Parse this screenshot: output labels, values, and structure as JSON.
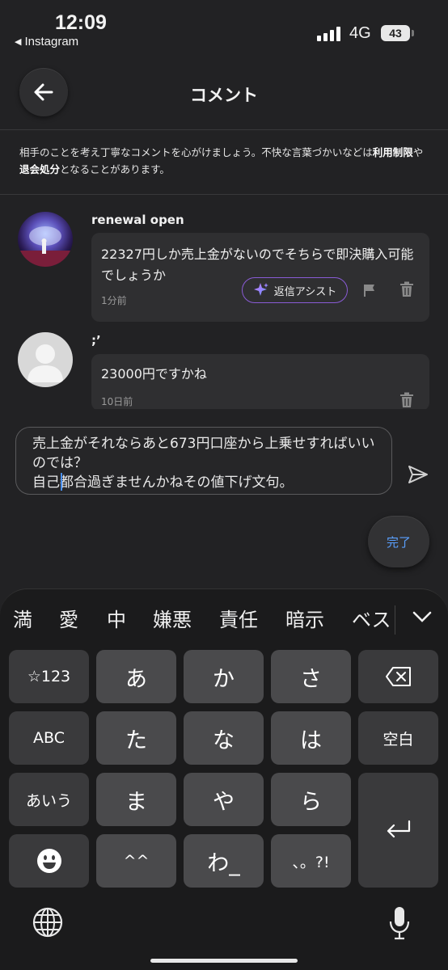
{
  "status_bar": {
    "time": "12:09",
    "back_app": "Instagram",
    "network": "4G",
    "battery": "43"
  },
  "header": {
    "title": "コメント"
  },
  "notice": {
    "text_1": "相手のことを考え丁寧なコメントを心がけましょう。不快な言葉づかいなどは",
    "bold_1": "利用制限",
    "text_2": "や",
    "bold_2": "退会処分",
    "text_3": "となることがあります。"
  },
  "comments": [
    {
      "username": "renewal open",
      "text": "22327円しか売上金がないのでそちらで即決購入可能でしょうか",
      "time": "1分前",
      "assist_label": "返信アシスト"
    },
    {
      "username": ";’",
      "text": "23000円ですかね",
      "time": "10日前"
    }
  ],
  "input": {
    "value": "売上金がそれならあと673円口座から上乗せすればいいのでは？\n自己都合過ぎませんかねその値下げ文句。"
  },
  "done_label": "完了",
  "keyboard": {
    "suggestions": [
      "満",
      "愛",
      "中",
      "嫌悪",
      "責任",
      "暗示",
      "ベス"
    ],
    "keys": {
      "num": "☆123",
      "a": "あ",
      "ka": "か",
      "sa": "さ",
      "abc": "ABC",
      "ta": "た",
      "na": "な",
      "ha": "は",
      "space": "空白",
      "kana": "あいう",
      "ma": "ま",
      "ya": "や",
      "ra": "ら",
      "dakuten": "^^",
      "wa": "わ_",
      "punct": "、。?!"
    }
  },
  "colors": {
    "background": "#222224",
    "bubble": "#2f2f31",
    "accent_blue": "#5aa0ff",
    "assist_border": "#8a5bd6"
  }
}
